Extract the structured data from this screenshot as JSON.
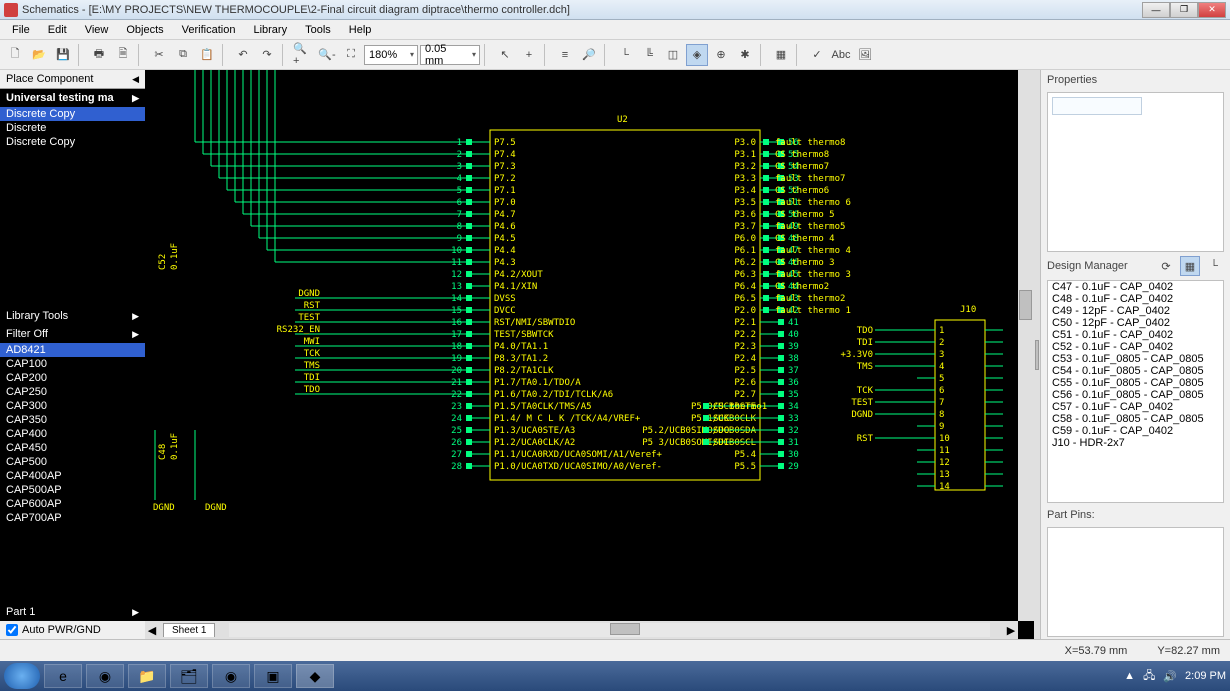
{
  "title": "Schematics - [E:\\MY PROJECTS\\NEW THERMOCOUPLE\\2-Final circuit diagram diptrace\\thermo controller.dch]",
  "menu": [
    "File",
    "Edit",
    "View",
    "Objects",
    "Verification",
    "Library",
    "Tools",
    "Help"
  ],
  "toolbar": {
    "zoom_value": "180%",
    "grid_value": "0.05 mm"
  },
  "left": {
    "place_component": "Place Component",
    "lib_title": "Universal testing ma",
    "top_list": [
      "Discrete Copy",
      "Discrete",
      "Discrete Copy"
    ],
    "lib_tools": "Library Tools",
    "filter": "Filter Off",
    "parts": [
      "AD8421",
      "CAP100",
      "CAP200",
      "CAP250",
      "CAP300",
      "CAP350",
      "CAP400",
      "CAP450",
      "CAP500",
      "CAP400AP",
      "CAP500AP",
      "CAP600AP",
      "CAP700AP"
    ],
    "part_label": "Part 1",
    "auto_pwr": "Auto PWR/GND"
  },
  "schematic": {
    "chip_ref": "U2",
    "conn_ref": "J10",
    "left_pins": [
      {
        "n": "1",
        "name": "P7.5"
      },
      {
        "n": "2",
        "name": "P7.4"
      },
      {
        "n": "3",
        "name": "P7.3"
      },
      {
        "n": "4",
        "name": "P7.2"
      },
      {
        "n": "5",
        "name": "P7.1"
      },
      {
        "n": "6",
        "name": "P7.0"
      },
      {
        "n": "7",
        "name": "P4.7"
      },
      {
        "n": "8",
        "name": "P4.6"
      },
      {
        "n": "9",
        "name": "P4.5"
      },
      {
        "n": "10",
        "name": "P4.4"
      },
      {
        "n": "11",
        "name": "P4.3"
      },
      {
        "n": "12",
        "name": "P4.2/XOUT"
      },
      {
        "n": "13",
        "name": "P4.1/XIN"
      },
      {
        "n": "14",
        "name": "DVSS"
      },
      {
        "n": "15",
        "name": "DVCC"
      },
      {
        "n": "16",
        "name": "RST/NMI/SBWTDIO"
      },
      {
        "n": "17",
        "name": "TEST/SBWTCK"
      },
      {
        "n": "18",
        "name": "P4.0/TA1.1"
      },
      {
        "n": "19",
        "name": "P8.3/TA1.2"
      },
      {
        "n": "20",
        "name": "P8.2/TA1CLK"
      },
      {
        "n": "21",
        "name": "P1.7/TA0.1/TDO/A"
      },
      {
        "n": "22",
        "name": "P1.6/TA0.2/TDI/TCLK/A6"
      },
      {
        "n": "23",
        "name": "P1.5/TA0CLK/TMS/A5"
      },
      {
        "n": "24",
        "name": "P1.4/ M C L K /TCK/A4/VREF+"
      },
      {
        "n": "25",
        "name": "P1.3/UCA0STE/A3"
      },
      {
        "n": "26",
        "name": "P1.2/UCA0CLK/A2"
      },
      {
        "n": "27",
        "name": "P1.1/UCA0RXD/UCA0SOMI/A1/Veref+"
      },
      {
        "n": "28",
        "name": "P1.0/UCA0TXD/UCA0SIMO/A0/Veref-"
      }
    ],
    "right_pins": [
      {
        "n": "56",
        "name": "P3.0"
      },
      {
        "n": "55",
        "name": "P3.1"
      },
      {
        "n": "54",
        "name": "P3.2"
      },
      {
        "n": "53",
        "name": "P3.3"
      },
      {
        "n": "52",
        "name": "P3.4"
      },
      {
        "n": "51",
        "name": "P3.5"
      },
      {
        "n": "50",
        "name": "P3.6"
      },
      {
        "n": "49",
        "name": "P3.7"
      },
      {
        "n": "48",
        "name": "P6.0"
      },
      {
        "n": "47",
        "name": "P6.1"
      },
      {
        "n": "46",
        "name": "P6.2"
      },
      {
        "n": "45",
        "name": "P6.3"
      },
      {
        "n": "44",
        "name": "P6.4"
      },
      {
        "n": "43",
        "name": "P6.5"
      },
      {
        "n": "42",
        "name": "P2.0"
      },
      {
        "n": "41",
        "name": "P2.1"
      },
      {
        "n": "40",
        "name": "P2.2"
      },
      {
        "n": "39",
        "name": "P2.3"
      },
      {
        "n": "38",
        "name": "P2.4"
      },
      {
        "n": "37",
        "name": "P2.5"
      },
      {
        "n": "36",
        "name": "P2.6"
      },
      {
        "n": "35",
        "name": "P2.7"
      },
      {
        "n": "34",
        "name": "P5.0/UCB0STE"
      },
      {
        "n": "33",
        "name": "P5.1/UCB0CLK"
      },
      {
        "n": "32",
        "name": "P5.2/UCB0SIMO/UCB0SDA"
      },
      {
        "n": "31",
        "name": "P5 3/UCB0SOMI/UCB0SCL"
      },
      {
        "n": "30",
        "name": "P5.4"
      },
      {
        "n": "29",
        "name": "P5.5"
      }
    ],
    "net_labels": [
      "fault thermo8",
      "CS thermo8",
      "CS thermo7",
      "fault thermo7",
      "CS thermo6",
      "fault thermo 6",
      "CS thermo 5",
      "fault thermo5",
      "CS thermo 4",
      "fault thermo 4",
      "CS thermo 3",
      "fault thermo 3",
      "CS thermo2",
      "fault thermo2",
      "fault thermo 1"
    ],
    "net_bottom": [
      "CS thermo1",
      "SCK",
      "SDO",
      "SDI"
    ],
    "j10_pins": [
      "TDO",
      "TDI",
      "+3.3V0",
      "TMS",
      "",
      "TCK",
      "TEST",
      "DGND",
      "",
      "RST",
      "",
      "",
      "",
      ""
    ],
    "left_nets": [
      "DGND",
      "RST",
      "TEST",
      "RS232_EN",
      "MWI",
      "TCK",
      "TMS",
      "TDI",
      "TDO"
    ],
    "caps": [
      "C48",
      "0.1uF",
      "C52",
      "0.1uF"
    ],
    "dgnd": "DGND"
  },
  "right": {
    "properties": "Properties",
    "design_manager": "Design Manager",
    "dm_list": [
      "C47 - 0.1uF - CAP_0402",
      "C48 - 0.1uF - CAP_0402",
      "C49 - 12pF - CAP_0402",
      "C50 - 12pF - CAP_0402",
      "C51 - 0.1uF - CAP_0402",
      "C52 - 0.1uF - CAP_0402",
      "C53 - 0.1uF_0805 - CAP_0805",
      "C54 - 0.1uF_0805 - CAP_0805",
      "C55 - 0.1uF_0805 - CAP_0805",
      "C56 - 0.1uF_0805 - CAP_0805",
      "C57 - 0.1uF - CAP_0402",
      "C58 - 0.1uF_0805 - CAP_0805",
      "C59 - 0.1uF - CAP_0402",
      "J10 - HDR-2x7"
    ],
    "part_pins": "Part Pins:"
  },
  "status": {
    "x": "X=53.79 mm",
    "y": "Y=82.27 mm"
  },
  "sheet": "Sheet 1",
  "time": "2:09 PM"
}
